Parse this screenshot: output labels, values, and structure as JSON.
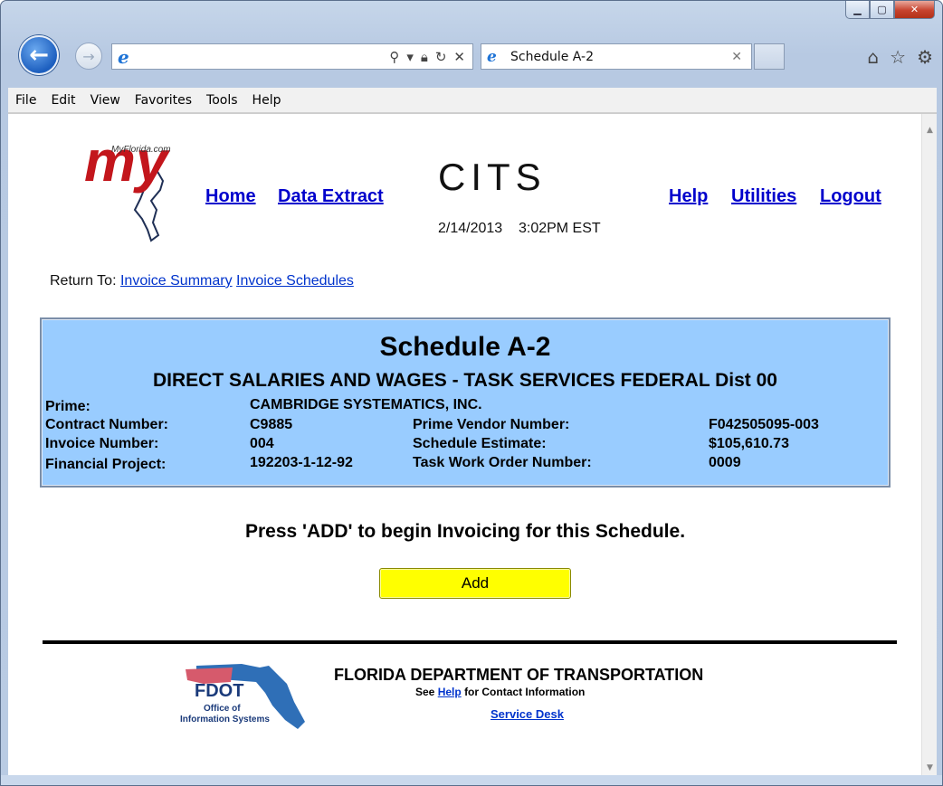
{
  "window": {
    "address_value": "",
    "tab_title": "Schedule A-2"
  },
  "menu": [
    "File",
    "Edit",
    "View",
    "Favorites",
    "Tools",
    "Help"
  ],
  "logo": {
    "small_text": "MyFlorida.com",
    "script_text": "my"
  },
  "nav": {
    "home": "Home",
    "data_extract": "Data Extract",
    "help": "Help",
    "utilities": "Utilities",
    "logout": "Logout"
  },
  "header": {
    "title": "CITS",
    "date": "2/14/2013",
    "time": "3:02PM EST"
  },
  "return_to": {
    "label": "Return To:",
    "links": [
      "Invoice Summary",
      "Invoice Schedules"
    ]
  },
  "schedule": {
    "title": "Schedule A-2",
    "subtitle": "DIRECT SALARIES AND WAGES - TASK SERVICES FEDERAL  Dist 00",
    "prime_label": "Prime:",
    "prime_value": "CAMBRIDGE SYSTEMATICS, INC.",
    "contract_label": "Contract Number:",
    "contract_value": "C9885",
    "vendor_label": "Prime Vendor Number:",
    "vendor_value": "F042505095-003",
    "invoice_label": "Invoice Number:",
    "invoice_value": "004",
    "estimate_label": "Schedule Estimate:",
    "estimate_value": "$105,610.73",
    "project_label": "Financial Project:",
    "project_value": "192203-1-12-92",
    "task_label": "Task Work Order Number:",
    "task_value": "0009"
  },
  "action": {
    "message": "Press 'ADD' to begin Invoicing for this Schedule.",
    "add_label": "Add"
  },
  "footer": {
    "fdot_logo_text": "FDOT",
    "fdot_logo_sub1": "Office of",
    "fdot_logo_sub2": "Information Systems",
    "dept_name": "FLORIDA DEPARTMENT OF TRANSPORTATION",
    "see_prefix": "See",
    "see_link": "Help",
    "see_suffix": "for Contact Information",
    "service_desk": "Service Desk"
  },
  "colors": {
    "schedule_bg": "#99ccff",
    "add_button_bg": "#ffff00",
    "link": "#0000cc"
  }
}
